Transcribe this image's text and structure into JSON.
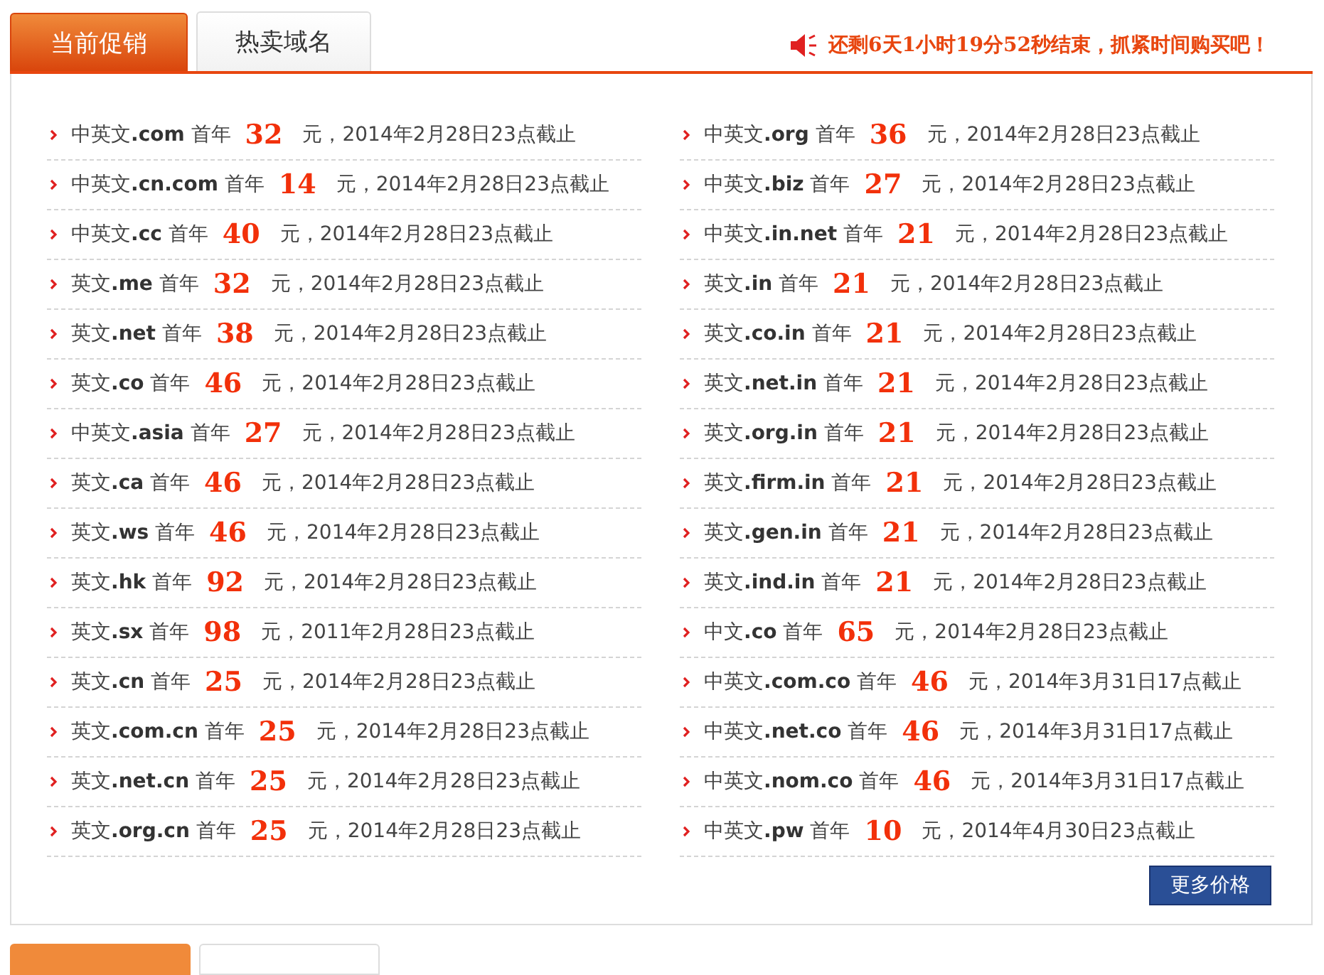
{
  "tabs": [
    {
      "label": "当前促销",
      "selected": true
    },
    {
      "label": "热卖域名",
      "selected": false
    }
  ],
  "notice": "还剩6天1小时19分52秒结束，抓紧时间购买吧！",
  "columns": [
    [
      {
        "name": "中英文**.com** 首年",
        "price": "32",
        "deadline": "元，2014年2月28日23点截止"
      },
      {
        "name": "中英文**.cn.com** 首年",
        "price": "14",
        "deadline": "元，2014年2月28日23点截止"
      },
      {
        "name": "中英文**.cc** 首年",
        "price": "40",
        "deadline": "元，2014年2月28日23点截止"
      },
      {
        "name": "英文**.me** 首年",
        "price": "32",
        "deadline": "元，2014年2月28日23点截止"
      },
      {
        "name": "英文**.net** 首年",
        "price": "38",
        "deadline": "元，2014年2月28日23点截止"
      },
      {
        "name": "英文**.co** 首年",
        "price": "46",
        "deadline": "元，2014年2月28日23点截止"
      },
      {
        "name": "中英文**.asia** 首年",
        "price": "27",
        "deadline": "元，2014年2月28日23点截止"
      },
      {
        "name": "英文**.ca** 首年",
        "price": "46",
        "deadline": "元，2014年2月28日23点截止"
      },
      {
        "name": "英文**.ws** 首年",
        "price": "46",
        "deadline": "元，2014年2月28日23点截止"
      },
      {
        "name": "英文**.hk** 首年",
        "price": "92",
        "deadline": "元，2014年2月28日23点截止"
      },
      {
        "name": "英文**.sx** 首年",
        "price": "98",
        "deadline": "元，2011年2月28日23点截止"
      },
      {
        "name": "英文**.cn** 首年",
        "price": "25",
        "deadline": "元，2014年2月28日23点截止"
      },
      {
        "name": "英文**.com.cn** 首年",
        "price": "25",
        "deadline": "元，2014年2月28日23点截止"
      },
      {
        "name": "英文**.net.cn** 首年",
        "price": "25",
        "deadline": "元，2014年2月28日23点截止"
      },
      {
        "name": "英文**.org.cn** 首年",
        "price": "25",
        "deadline": "元，2014年2月28日23点截止"
      }
    ],
    [
      {
        "name": "中英文**.org** 首年",
        "price": "36",
        "deadline": "元，2014年2月28日23点截止"
      },
      {
        "name": "中英文**.biz** 首年",
        "price": "27",
        "deadline": "元，2014年2月28日23点截止"
      },
      {
        "name": "中英文**.in.net** 首年",
        "price": "21",
        "deadline": "元，2014年2月28日23点截止"
      },
      {
        "name": "英文**.in** 首年",
        "price": "21",
        "deadline": "元，2014年2月28日23点截止"
      },
      {
        "name": "英文**.co.in** 首年",
        "price": "21",
        "deadline": "元，2014年2月28日23点截止"
      },
      {
        "name": "英文**.net.in** 首年",
        "price": "21",
        "deadline": "元，2014年2月28日23点截止"
      },
      {
        "name": "英文**.org.in** 首年",
        "price": "21",
        "deadline": "元，2014年2月28日23点截止"
      },
      {
        "name": "英文**.firm.in** 首年",
        "price": "21",
        "deadline": "元，2014年2月28日23点截止"
      },
      {
        "name": "英文**.gen.in** 首年",
        "price": "21",
        "deadline": "元，2014年2月28日23点截止"
      },
      {
        "name": "英文**.ind.in** 首年",
        "price": "21",
        "deadline": "元，2014年2月28日23点截止"
      },
      {
        "name": "中文**.co** 首年",
        "price": "65",
        "deadline": "元，2014年2月28日23点截止"
      },
      {
        "name": "中英文**.com.co** 首年",
        "price": "46",
        "deadline": "元，2014年3月31日17点截止"
      },
      {
        "name": "中英文**.net.co** 首年",
        "price": "46",
        "deadline": "元，2014年3月31日17点截止"
      },
      {
        "name": "中英文**.nom.co** 首年",
        "price": "46",
        "deadline": "元，2014年3月31日17点截止"
      },
      {
        "name": "中英文**.pw** 首年",
        "price": "10",
        "deadline": "元，2014年4月30日23点截止"
      }
    ]
  ],
  "more_button": "更多价格",
  "next_tabs": [
    {
      "selected": true
    },
    {
      "selected": false
    }
  ]
}
